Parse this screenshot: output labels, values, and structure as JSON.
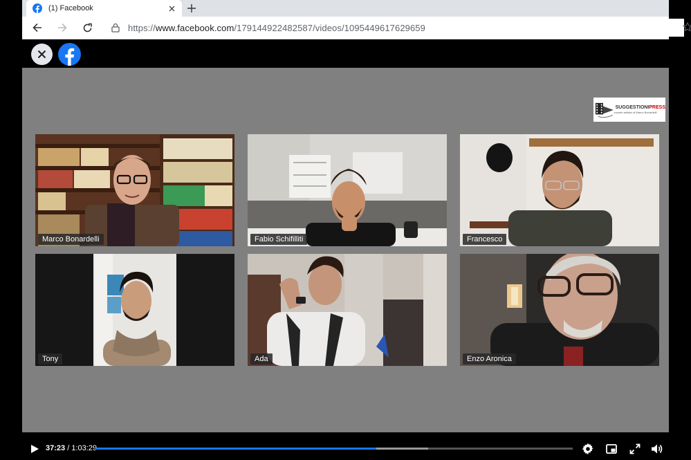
{
  "browser": {
    "tab_title": "(1) Facebook",
    "url_prefix": "https://",
    "url_host": "www.facebook.com",
    "url_path": "/179144922482587/videos/1095449617629659"
  },
  "stage": {
    "sponsor_brand": "SUGGESTIONI",
    "sponsor_brand_accent": "PRESS",
    "sponsor_sub": "incontri artistici di Marco Bonardelli"
  },
  "participants": [
    {
      "name": "Marco Bonardelli"
    },
    {
      "name": "Fabio Schifilliti"
    },
    {
      "name": "Francesco"
    },
    {
      "name": "Tony"
    },
    {
      "name": "Ada"
    },
    {
      "name": "Enzo Aronica"
    }
  ],
  "player": {
    "current_time": "37:23",
    "separator": " / ",
    "duration": "1:03:29",
    "progress_fraction": 0.589,
    "buffer_fraction": 0.697
  },
  "colors": {
    "facebook_blue": "#1877f2",
    "stage_bg": "#808080"
  }
}
